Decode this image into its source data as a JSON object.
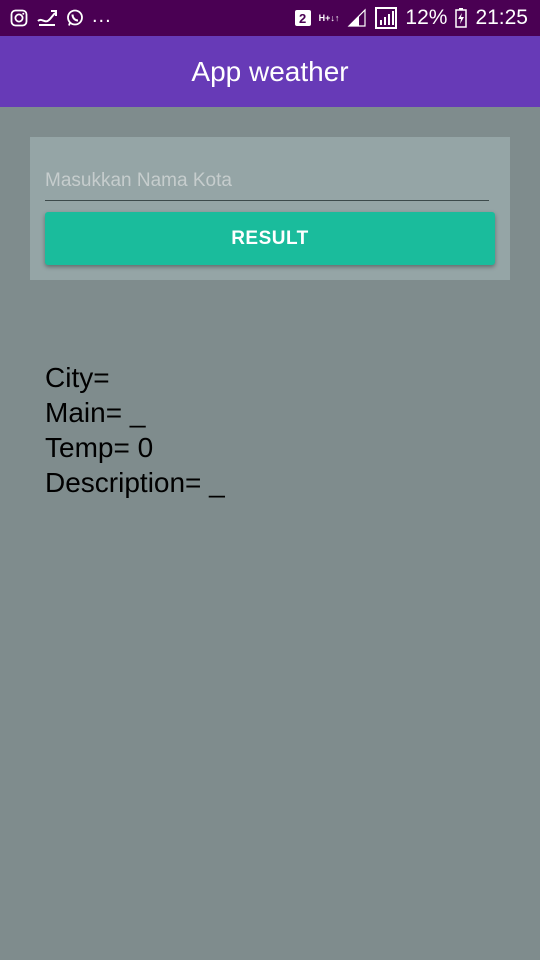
{
  "status_bar": {
    "left_icons": [
      "instagram-icon",
      "download-icon",
      "whatsapp-icon"
    ],
    "more": "...",
    "sim_badge": "2",
    "network_type_top": "H+",
    "network_type_bottom": "↓↑",
    "battery_percent": "12%",
    "time": "21:25"
  },
  "app_bar": {
    "title": "App weather"
  },
  "form": {
    "city_placeholder": "Masukkan Nama Kota",
    "city_value": "",
    "button_label": "RESULT"
  },
  "results": {
    "city": "City=",
    "main": "Main= _",
    "temp": "Temp= 0",
    "description": "Description= _"
  },
  "colors": {
    "status_bar": "#4a0053",
    "app_bar": "#673ab7",
    "background": "#7f8c8d",
    "card": "#95a5a6",
    "button": "#1abc9c"
  }
}
